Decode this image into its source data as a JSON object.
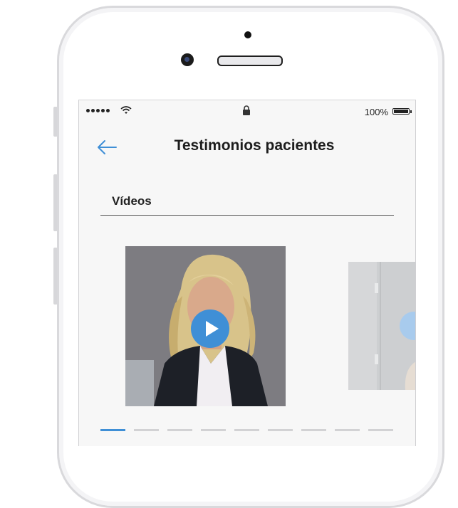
{
  "status_bar": {
    "battery_text": "100%"
  },
  "header": {
    "title": "Testimonios pacientes"
  },
  "section": {
    "label": "Vídeos"
  },
  "carousel": {
    "total_pages": 9,
    "active_page": 1
  },
  "colors": {
    "accent": "#3f8fd6",
    "screen_bg": "#f7f7f7"
  }
}
